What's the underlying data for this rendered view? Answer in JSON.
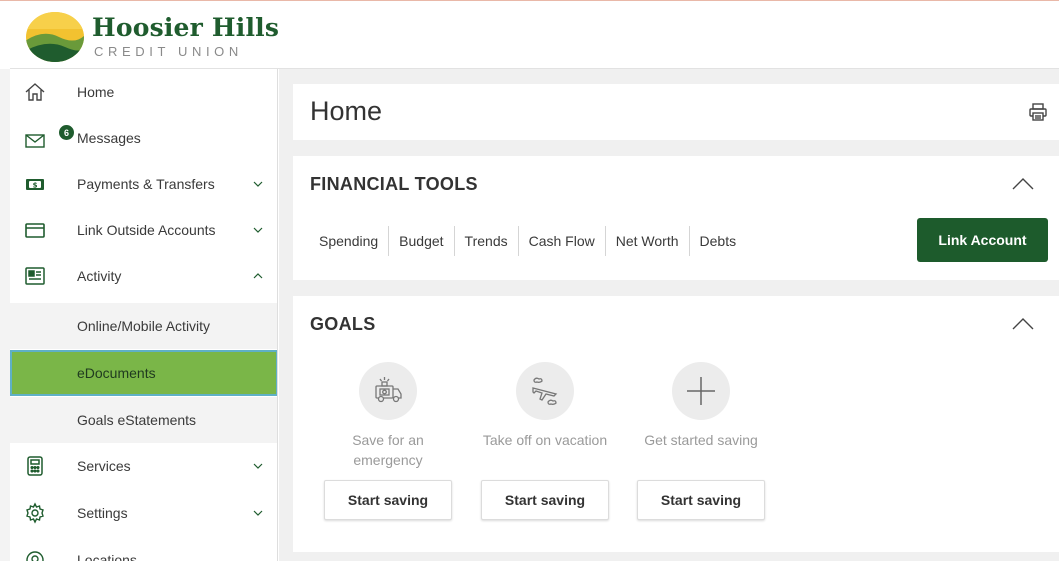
{
  "brand": {
    "name": "Hoosier Hills",
    "subtitle": "CREDIT UNION"
  },
  "sidebar": {
    "items": [
      {
        "label": "Home",
        "icon": "home-icon"
      },
      {
        "label": "Messages",
        "icon": "envelope-icon",
        "badge": "6"
      },
      {
        "label": "Payments & Transfers",
        "icon": "dollar-bill-icon"
      },
      {
        "label": "Link Outside Accounts",
        "icon": "card-icon"
      },
      {
        "label": "Activity",
        "icon": "activity-icon"
      },
      {
        "label": "Services",
        "icon": "calculator-icon"
      },
      {
        "label": "Settings",
        "icon": "gear-icon"
      },
      {
        "label": "Locations",
        "icon": "location-icon"
      }
    ],
    "activity_sub": [
      {
        "label": "Online/Mobile Activity"
      },
      {
        "label": "eDocuments",
        "active": true
      },
      {
        "label": "Goals eStatements"
      }
    ]
  },
  "main": {
    "title": "Home",
    "financial_tools": {
      "title": "FINANCIAL TOOLS",
      "tabs": [
        "Spending",
        "Budget",
        "Trends",
        "Cash Flow",
        "Net Worth",
        "Debts"
      ],
      "link_button": "Link Account"
    },
    "goals": {
      "title": "GOALS",
      "items": [
        {
          "text": "Save for an emergency",
          "button": "Start saving",
          "icon": "emergency-van-icon"
        },
        {
          "text": "Take off on vacation",
          "button": "Start saving",
          "icon": "airplane-icon"
        },
        {
          "text": "Get started saving",
          "button": "Start saving",
          "icon": "plus-icon"
        }
      ]
    }
  },
  "colors": {
    "brand_green": "#1d5b2c",
    "active_green": "#7ab648",
    "active_border": "#5fb0c6"
  }
}
